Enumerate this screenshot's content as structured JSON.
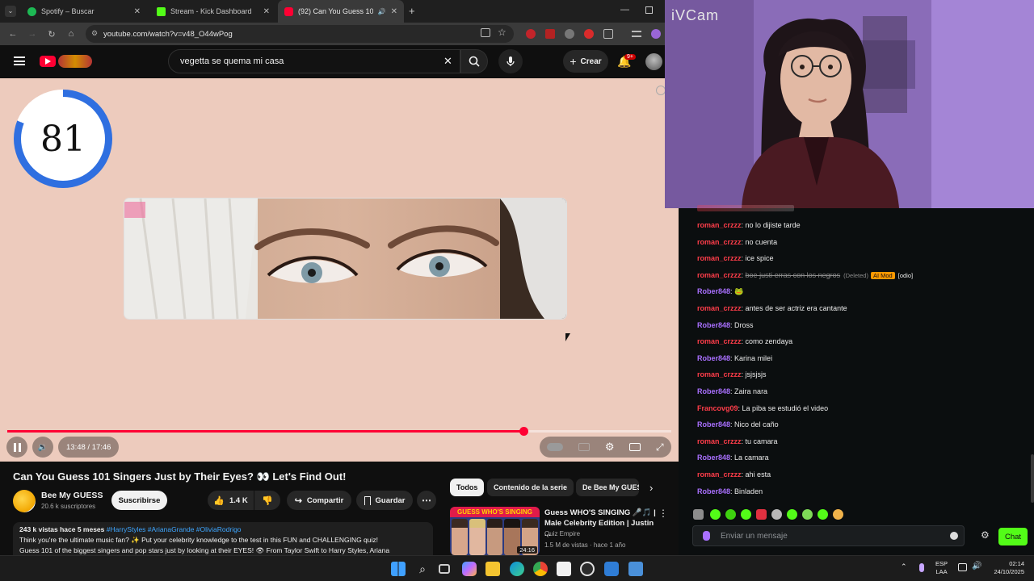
{
  "browser": {
    "tabs": [
      {
        "label": "Spotify – Buscar",
        "color": "#1db954",
        "active": false
      },
      {
        "label": "Stream - Kick Dashboard",
        "color": "#53fc18",
        "active": false
      },
      {
        "label": "(92) Can You Guess 101 Sing",
        "color": "#ff0033",
        "active": true
      }
    ],
    "url": "youtube.com/watch?v=v48_O44wPog"
  },
  "youtube": {
    "search_query": "vegetta se quema mi casa",
    "create_label": "Crear",
    "notif_count": "9+"
  },
  "player": {
    "countdown": "81",
    "countdown_fraction": 0.81,
    "time_display": "13:48 / 17:46",
    "progress_fraction": 0.777
  },
  "video_info": {
    "title": "Can You Guess 101 Singers Just by Their Eyes? 👀 Let's Find Out!",
    "channel_name": "Bee My GUESS",
    "subscribers": "20.6 k suscriptores",
    "subscribe_label": "Suscribirse",
    "like_count": "1.4 K",
    "share_label": "Compartir",
    "save_label": "Guardar",
    "views_date": "243 k vistas  hace 5 meses",
    "hashtags": "#HarryStyles #ArianaGrande #OliviaRodrigo",
    "description_line1": "Think you're the ultimate music fan? ✨ Put your celebrity knowledge to the test in this FUN and CHALLENGING quiz!",
    "description_line2": "Guess 101 of the biggest singers and pop stars just by looking at their EYES! 👁 From Taylor Swift to Harry Styles, Ariana"
  },
  "recommendations": {
    "chips": [
      "Todos",
      "Contenido de la serie",
      "De Bee My GUESS"
    ],
    "item": {
      "thumb_banner": "GUESS WHO'S SINGING",
      "duration": "24:16",
      "title": "Guess WHO'S SINGING 🎤🎵 | Male Celebrity Edition | Justin ...",
      "channel": "Quiz Empire",
      "meta": "1.5 M de vistas · hace 1 año"
    }
  },
  "webcam": {
    "watermark": "iVCam"
  },
  "chat": {
    "messages": [
      {
        "user": "roman_crzzz",
        "text": "no lo dijiste tarde",
        "cls": "u-roman",
        "deleted": false
      },
      {
        "user": "roman_crzzz",
        "text": "no cuenta",
        "cls": "u-roman",
        "deleted": false
      },
      {
        "user": "roman_crzzz",
        "text": "ice spice",
        "cls": "u-roman",
        "deleted": false
      },
      {
        "user": "roman_crzzz",
        "text": "boe justi erras con los negros",
        "cls": "u-roman",
        "deleted": true,
        "deleted_label": "(Deleted)",
        "mod_label": "AI Mod",
        "reason": "[odio]"
      },
      {
        "user": "Rober848",
        "text": "🐸",
        "cls": "u-rober",
        "deleted": false
      },
      {
        "user": "roman_crzzz",
        "text": "antes de ser actriz era cantante",
        "cls": "u-roman",
        "deleted": false
      },
      {
        "user": "Rober848",
        "text": "Dross",
        "cls": "u-rober",
        "deleted": false
      },
      {
        "user": "roman_crzzz",
        "text": "como zendaya",
        "cls": "u-roman",
        "deleted": false
      },
      {
        "user": "Rober848",
        "text": "Karina milei",
        "cls": "u-rober",
        "deleted": false
      },
      {
        "user": "roman_crzzz",
        "text": "jsjsjsjs",
        "cls": "u-roman",
        "deleted": false
      },
      {
        "user": "Rober848",
        "text": "Zaira nara",
        "cls": "u-rober",
        "deleted": false
      },
      {
        "user": "Francovg09",
        "text": "La piba se estudió el video",
        "cls": "u-franco",
        "deleted": false
      },
      {
        "user": "Rober848",
        "text": "Nico del caño",
        "cls": "u-rober",
        "deleted": false
      },
      {
        "user": "roman_crzzz",
        "text": "tu camara",
        "cls": "u-roman",
        "deleted": false
      },
      {
        "user": "Rober848",
        "text": "La camara",
        "cls": "u-rober",
        "deleted": false
      },
      {
        "user": "roman_crzzz",
        "text": "ahi esta",
        "cls": "u-roman",
        "deleted": false
      },
      {
        "user": "Rober848",
        "text": "Binladen",
        "cls": "u-rober",
        "deleted": false
      }
    ],
    "input_placeholder": "Enviar un mensaje",
    "send_label": "Chat"
  },
  "taskbar": {
    "lang_line1": "ESP",
    "lang_line2": "LAA",
    "time": "02:14",
    "date": "24/10/2025"
  },
  "colors": {
    "kick_green": "#53fc18",
    "youtube_red": "#ff0033",
    "timer_blue": "#2f6fe0",
    "video_bg": "#edcbbd"
  }
}
